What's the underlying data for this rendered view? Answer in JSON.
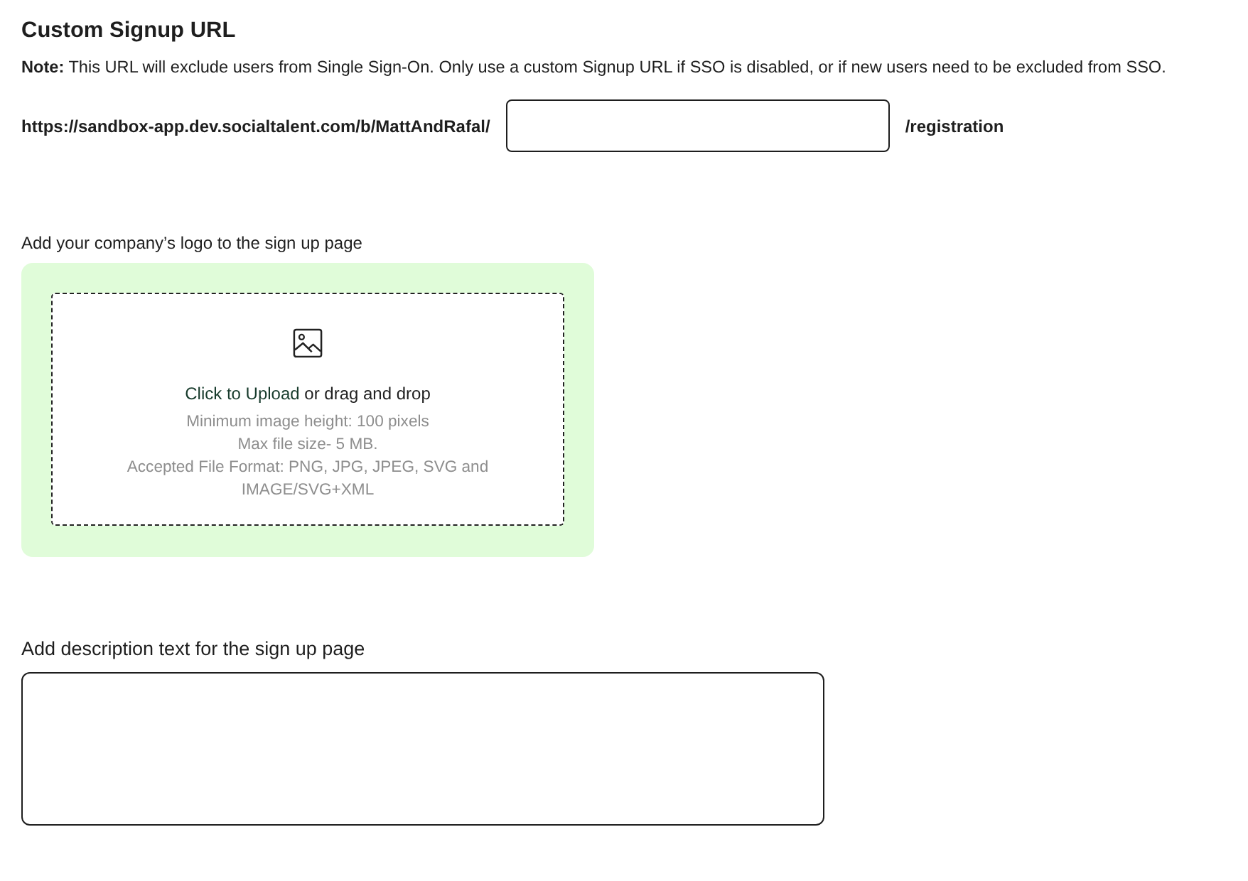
{
  "title": "Custom Signup URL",
  "note": "**Note:** This URL will exclude users from Single Sign-On. Only use a custom Signup URL if SSO is disabled, or if new users need to be excluded from SSO.",
  "url_row": {
    "prefix": "https://sandbox-app.dev.socialtalent.com/b/MattAndRafal/",
    "suffix": "/registration"
  },
  "logo_upload": {
    "label": "Add your company’s logo to the sign up page",
    "upload_link": "Click to Upload",
    "upload_text": "or drag and drop",
    "requirements": [
      "Minimum image height: 100 pixels",
      "Max file size- 5 MB.",
      "Accepted File Format: PNG, JPG, JPEG, SVG and IMAGE/SVG+XML"
    ]
  },
  "description": {
    "label": "Add description text for the sign up page"
  }
}
